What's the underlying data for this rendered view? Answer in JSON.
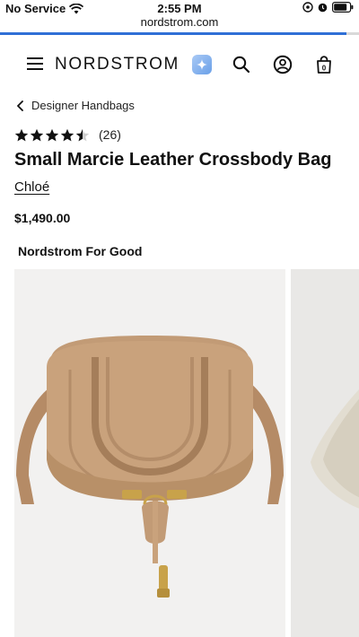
{
  "status_bar": {
    "carrier": "No Service",
    "time": "2:55 PM",
    "url": "nordstrom.com"
  },
  "header": {
    "logo": "NORDSTROM",
    "icons": [
      "menu-icon",
      "ai-sparkle-icon",
      "search-icon",
      "account-icon",
      "bag-icon"
    ],
    "bag_count": "0"
  },
  "breadcrumb": {
    "label": "Designer Handbags"
  },
  "product": {
    "rating": 4.5,
    "rating_max": 5,
    "review_count": "(26)",
    "title": "Small Marcie Leather Crossbody Bag",
    "brand": "Chloé",
    "price": "$1,490.00",
    "promo_label": "Nordstrom For Good"
  },
  "colors": {
    "accent_line": "#2f6fd6",
    "bag_tan": "#c9a27c",
    "hardware_gold": "#c8a24a"
  }
}
